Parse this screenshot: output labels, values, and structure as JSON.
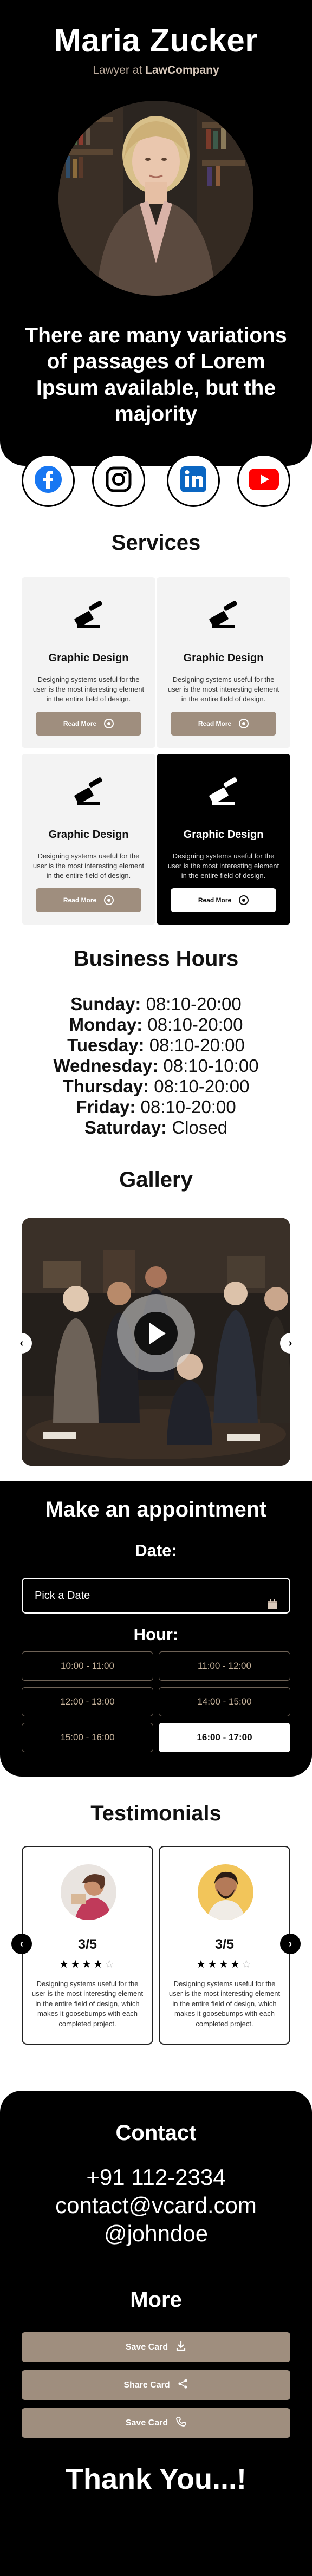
{
  "profile": {
    "name": "Maria Zucker",
    "role_prefix": "Lawyer at",
    "company": "LawCompany",
    "tagline": "There are many variations of passages of Lorem Ipsum available, but the majority"
  },
  "socials": [
    {
      "name": "facebook",
      "icon": "facebook-icon",
      "color": "#1877f2"
    },
    {
      "name": "instagram",
      "icon": "instagram-icon",
      "color": "#000000"
    },
    {
      "name": "linkedin",
      "icon": "linkedin-icon",
      "color": "#0a66c2"
    },
    {
      "name": "youtube",
      "icon": "youtube-icon",
      "color": "#ff0000"
    }
  ],
  "services": {
    "title": "Services",
    "items": [
      {
        "title": "Graphic Design",
        "desc": "Designing systems useful for the user is the most interesting element in the entire field of design.",
        "button": "Read More"
      },
      {
        "title": "Graphic Design",
        "desc": "Designing systems useful for the user is the most interesting element in the entire field of design.",
        "button": "Read More"
      },
      {
        "title": "Graphic Design",
        "desc": "Designing systems useful for the user is the most interesting element in the entire field of design.",
        "button": "Read More"
      },
      {
        "title": "Graphic Design",
        "desc": "Designing systems useful for the user is the most interesting element in the entire field of design.",
        "button": "Read More"
      }
    ]
  },
  "hours": {
    "title": "Business Hours",
    "rows": [
      {
        "day": "Sunday:",
        "time": "08:10-20:00"
      },
      {
        "day": "Monday:",
        "time": "08:10-20:00"
      },
      {
        "day": "Tuesday:",
        "time": "08:10-20:00"
      },
      {
        "day": "Wednesday:",
        "time": "08:10-10:00"
      },
      {
        "day": "Thursday:",
        "time": "08:10-20:00"
      },
      {
        "day": "Friday:",
        "time": "08:10-20:00"
      },
      {
        "day": "Saturday:",
        "time": "Closed"
      }
    ]
  },
  "gallery": {
    "title": "Gallery"
  },
  "appointment": {
    "title": "Make an appointment",
    "date_label": "Date:",
    "date_placeholder": "Pick a Date",
    "hour_label": "Hour:",
    "slots": [
      "10:00 - 11:00",
      "11:00 - 12:00",
      "12:00 - 13:00",
      "14:00 - 15:00",
      "15:00 - 16:00",
      "16:00 - 17:00"
    ],
    "selected_slot": "16:00 - 17:00"
  },
  "testimonials": {
    "title": "Testimonials",
    "items": [
      {
        "rating": "3/5",
        "stars": 4,
        "text": "Designing systems useful for the user is the most interesting element in the entire field of design, which makes it goosebumps with each completed project."
      },
      {
        "rating": "3/5",
        "stars": 4,
        "text": "Designing systems useful for the user is the most interesting element in the entire field of design, which makes it goosebumps with each completed project."
      }
    ]
  },
  "contact": {
    "title": "Contact",
    "phone": "+91 112-2334",
    "email": "contact@vcard.com",
    "handle": "@johndoe"
  },
  "more": {
    "title": "More",
    "buttons": [
      {
        "label": "Save Card",
        "icon": "download-icon"
      },
      {
        "label": "Share Card",
        "icon": "share-icon"
      },
      {
        "label": "Save Card",
        "icon": "phone-icon"
      }
    ]
  },
  "footer": {
    "thanks": "Thank You...!"
  },
  "colors": {
    "accent": "#9f8e7e",
    "dark": "#000000",
    "light_card": "#f3f3f3"
  }
}
